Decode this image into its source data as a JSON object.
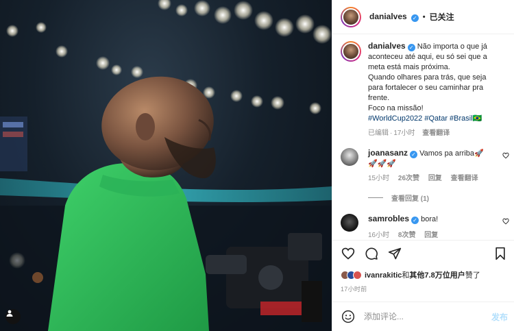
{
  "post": {
    "username": "danialves",
    "follow_state": "已关注",
    "caption": {
      "lines": [
        "Não importa o que já",
        "aconteceu até aqui, eu só sei que a",
        "meta está mais próxima.",
        "Quando olhares para trás, que seja",
        "para fortalecer o seu caminhar pra",
        "frente.",
        "Foco na missão!"
      ],
      "hashtags": "#WorldCup2022 #Qatar #Brasil🇧🇷",
      "edited": "已编辑",
      "time": "17小时",
      "translate": "查看翻译"
    }
  },
  "comments": [
    {
      "username": "joanasanz",
      "text_line1": "Vamos pa arriba🚀",
      "text_line2": "🚀🚀🚀",
      "time": "15小时",
      "likes": "26次赞",
      "reply": "回复",
      "translate": "查看翻译",
      "view_replies": "查看回复 (1)"
    },
    {
      "username": "samrobles",
      "text_line1": "bora!",
      "time": "16小时",
      "likes": "8次赞",
      "reply": "回复"
    }
  ],
  "likes": {
    "first_user": "ivanrakitic",
    "connector": "和",
    "others": "其他7.8万位用户",
    "suffix": "赞了"
  },
  "timestamp": "17小时前",
  "comment_box": {
    "placeholder": "添加评论...",
    "post_label": "发布"
  },
  "icons": {
    "like": "heart-icon",
    "comment": "comment-icon",
    "share": "share-icon",
    "save": "bookmark-icon",
    "emoji": "emoji-icon",
    "tag": "user-tag-icon"
  },
  "colors": {
    "verified": "#3897f0",
    "hashtag": "#00376b",
    "muted": "#8e8e8e",
    "post_disabled": "#b2dffc",
    "jersey": "#2fbf5a"
  }
}
